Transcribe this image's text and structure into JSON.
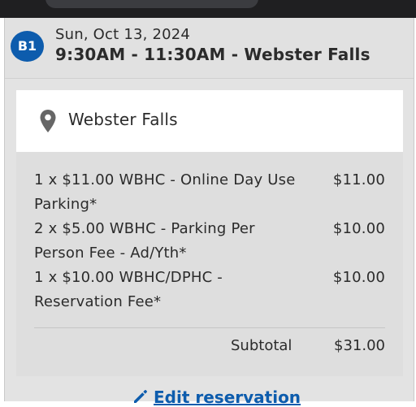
{
  "reservation": {
    "badge": "B1",
    "date": "Sun, Oct 13, 2024",
    "time_location": "9:30AM - 11:30AM - Webster Falls"
  },
  "location": {
    "icon": "map-pin-icon",
    "name": "Webster Falls"
  },
  "line_items": [
    {
      "description": "1 x $11.00 WBHC - Online Day Use Parking*",
      "amount": "$11.00"
    },
    {
      "description": "2 x $5.00 WBHC - Parking Per Person Fee - Ad/Yth*",
      "amount": "$10.00"
    },
    {
      "description": "1 x $10.00 WBHC/DPHC - Reservation Fee*",
      "amount": "$10.00"
    }
  ],
  "subtotal": {
    "label": "Subtotal",
    "amount": "$31.00"
  },
  "actions": {
    "edit_label": "Edit reservation",
    "edit_icon": "pencil-icon"
  },
  "colors": {
    "accent": "#0d5cad",
    "top_bar": "#1f1f21"
  }
}
